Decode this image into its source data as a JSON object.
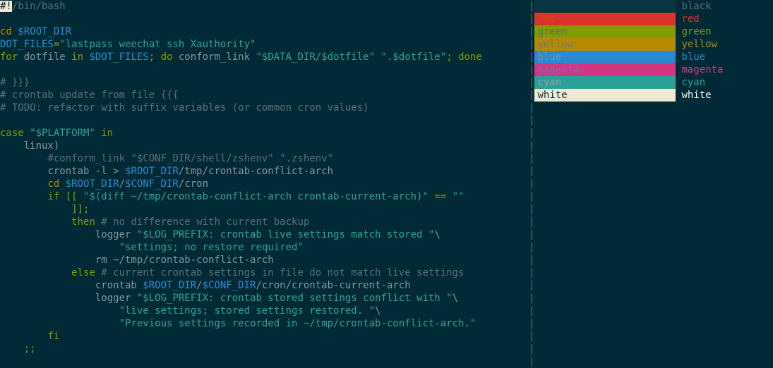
{
  "code": {
    "shebang_hash": "#!",
    "shebang_path": "/bin/bash",
    "l3": {
      "cd": "cd",
      "var": "$ROOT_DIR"
    },
    "l4": {
      "var": "DOT_FILES",
      "eq": "=",
      "str": "\"lastpass weechat ssh Xauthority\""
    },
    "l5": {
      "for": "for",
      "iter": " dotfile ",
      "in": "in",
      "var": " $DOT_FILES",
      "semi": "; ",
      "do": "do",
      "cmd": " conform_link ",
      "str1": "\"$DATA_DIR/$dotfile\"",
      "sp": " ",
      "str2": "\".$dotfile\"",
      "semi2": "; ",
      "done": "done"
    },
    "l7": "# }}}",
    "l8": "# crontab update from file {{{",
    "l9": "# TODO: refactor with suffix variables (or common cron values)",
    "l11": {
      "case": "case",
      "str": " \"$PLATFORM\" ",
      "in": "in"
    },
    "l12": "    linux)",
    "l13": {
      "indent": "        ",
      "comment": "#conform_link \"$CONF_DIR/shell/zshenv\" \".zshenv\""
    },
    "l14": {
      "indent": "        ",
      "cmd": "crontab -l > ",
      "var": "$ROOT_DIR",
      "rest": "/tmp/crontab-conflict-arch"
    },
    "l15": {
      "indent": "        ",
      "cd": "cd ",
      "var1": "$ROOT_DIR",
      "slash": "/",
      "var2": "$CONF_DIR",
      "rest": "/cron"
    },
    "l16": {
      "indent": "        ",
      "if": "if",
      "open": " [[ ",
      "str1": "\"$(diff ~/tmp/crontab-conflict-arch crontab-current-arch)\"",
      "eq": " == ",
      "str2": "\"\""
    },
    "l17": "            ]];",
    "l18": {
      "indent": "            ",
      "then": "then",
      "comment": " # no difference with current backup"
    },
    "l19": {
      "indent": "                ",
      "cmd": "logger ",
      "str": "\"$LOG_PREFIX: crontab live settings match stored \"",
      "bs": "\\"
    },
    "l20": {
      "indent": "                    ",
      "str": "\"settings; no restore required\""
    },
    "l21": {
      "indent": "                ",
      "cmd": "rm ~/tmp/crontab-conflict-arch"
    },
    "l22": {
      "indent": "            ",
      "else": "else",
      "comment": " # current crontab settings in file do not match live settings"
    },
    "l23": {
      "indent": "                ",
      "cmd": "crontab ",
      "var1": "$ROOT_DIR",
      "slash": "/",
      "var2": "$CONF_DIR",
      "rest": "/cron/crontab-current-arch"
    },
    "l24": {
      "indent": "                ",
      "cmd": "logger ",
      "str": "\"$LOG_PREFIX: crontab stored settings conflict with \"",
      "bs": "\\"
    },
    "l25": {
      "indent": "                    ",
      "str": "\"live settings; stored settings restored. \"",
      "bs": "\\"
    },
    "l26": {
      "indent": "                    ",
      "str": "\"Previous settings recorded in ~/tmp/crontab-conflict-arch.\""
    },
    "l27": {
      "indent": "        ",
      "fi": "fi"
    },
    "l28": "    ;;"
  },
  "colors": [
    {
      "name": "black",
      "swatch_bg": "bg-black",
      "swatch_txt": "t-black",
      "label_cls": "c-black"
    },
    {
      "name": "red",
      "swatch_bg": "bg-red",
      "swatch_txt": "t-red",
      "label_cls": "c-red"
    },
    {
      "name": "green",
      "swatch_bg": "bg-green",
      "swatch_txt": "t-green",
      "label_cls": "c-green"
    },
    {
      "name": "yellow",
      "swatch_bg": "bg-yellow",
      "swatch_txt": "t-yellow",
      "label_cls": "c-yellow"
    },
    {
      "name": "blue",
      "swatch_bg": "bg-blue",
      "swatch_txt": "t-blue",
      "label_cls": "c-blue"
    },
    {
      "name": "magenta",
      "swatch_bg": "bg-magenta",
      "swatch_txt": "t-magenta",
      "label_cls": "c-magenta"
    },
    {
      "name": "cyan",
      "swatch_bg": "bg-cyan",
      "swatch_txt": "t-cyan",
      "label_cls": "c-cyan"
    },
    {
      "name": "white",
      "swatch_bg": "bg-white",
      "swatch_txt": "t-white",
      "label_cls": "c-white"
    }
  ],
  "bar": "|"
}
